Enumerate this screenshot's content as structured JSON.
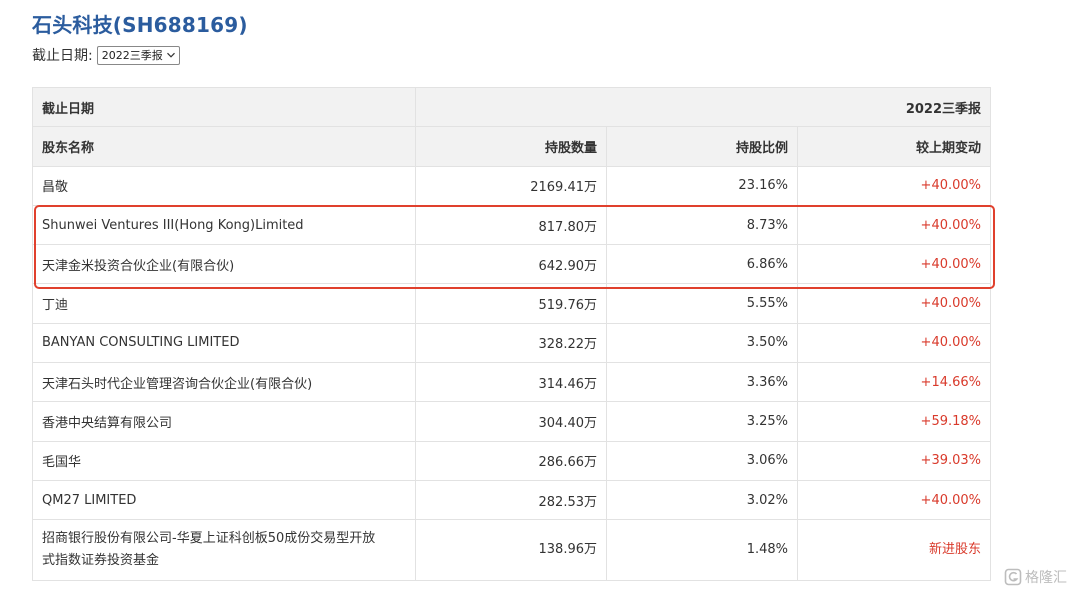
{
  "header": {
    "title": "石头科技(SH688169)",
    "date_label": "截止日期:",
    "date_selected": "2022三季报"
  },
  "table": {
    "period_label": "截止日期",
    "period_value": "2022三季报",
    "columns": [
      "股东名称",
      "持股数量",
      "持股比例",
      "较上期变动"
    ],
    "rows": [
      {
        "name": "昌敬",
        "shares": "2169.41万",
        "pct": "23.16%",
        "change": "+40.00%"
      },
      {
        "name": "Shunwei Ventures III(Hong Kong)Limited",
        "shares": "817.80万",
        "pct": "8.73%",
        "change": "+40.00%"
      },
      {
        "name": "天津金米投资合伙企业(有限合伙)",
        "shares": "642.90万",
        "pct": "6.86%",
        "change": "+40.00%"
      },
      {
        "name": "丁迪",
        "shares": "519.76万",
        "pct": "5.55%",
        "change": "+40.00%"
      },
      {
        "name": "BANYAN CONSULTING LIMITED",
        "shares": "328.22万",
        "pct": "3.50%",
        "change": "+40.00%"
      },
      {
        "name": "天津石头时代企业管理咨询合伙企业(有限合伙)",
        "shares": "314.46万",
        "pct": "3.36%",
        "change": "+14.66%"
      },
      {
        "name": "香港中央结算有限公司",
        "shares": "304.40万",
        "pct": "3.25%",
        "change": "+59.18%"
      },
      {
        "name": "毛国华",
        "shares": "286.66万",
        "pct": "3.06%",
        "change": "+39.03%"
      },
      {
        "name": "QM27 LIMITED",
        "shares": "282.53万",
        "pct": "3.02%",
        "change": "+40.00%"
      }
    ],
    "last_row": {
      "name_line1": "招商银行股份有限公司-华夏上证科创板50成份交易型开放",
      "name_line2": "式指数证券投资基金",
      "shares": "138.96万",
      "pct": "1.48%",
      "change": "新进股东"
    }
  },
  "watermark": {
    "text": "格隆汇",
    "icon": "gelonghui-logo-icon"
  },
  "colors": {
    "title": "#2b5c9e",
    "change_red": "#d93a2b",
    "highlight_border": "#e0402d",
    "header_bg": "#f2f2f2"
  }
}
